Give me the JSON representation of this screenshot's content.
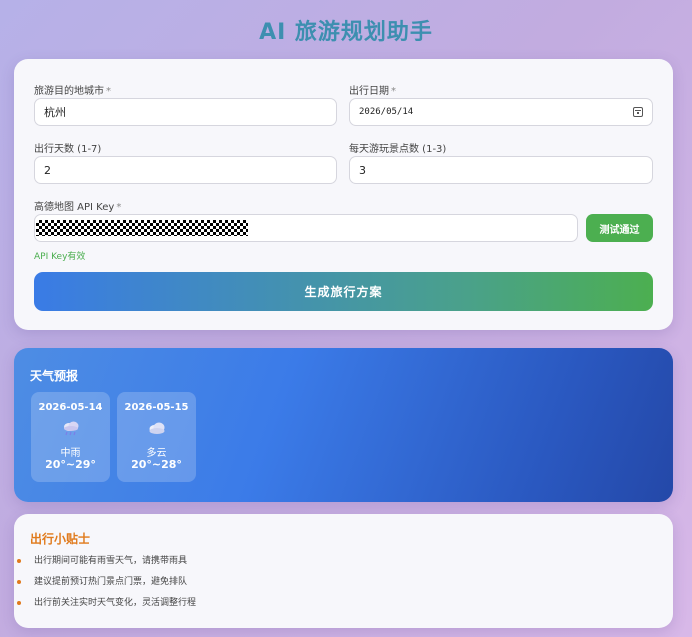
{
  "app": {
    "title": "AI 旅游规划助手"
  },
  "form": {
    "city": {
      "label": "旅游目的地城市",
      "required": "*",
      "value": "杭州"
    },
    "date": {
      "label": "出行日期",
      "required": "*",
      "value": "2026/05/14"
    },
    "days": {
      "label": "出行天数 (1-7)",
      "value": "2"
    },
    "spots": {
      "label": "每天游玩景点数 (1-3)",
      "value": "3"
    },
    "api_key": {
      "label": "高德地图 API Key",
      "required": "*"
    },
    "test_button_label": "测试通过",
    "api_status": "API Key有效",
    "generate_button_label": "生成旅行方案"
  },
  "weather": {
    "title": "天气预报",
    "days": [
      {
        "date": "2026-05-14",
        "icon": "rain-cloud-icon",
        "condition": "中雨",
        "temp": "20°~29°"
      },
      {
        "date": "2026-05-15",
        "icon": "cloud-icon",
        "condition": "多云",
        "temp": "20°~28°"
      }
    ]
  },
  "tips": {
    "title": "出行小贴士",
    "items": [
      "出行期间可能有雨雪天气，请携带雨具",
      "建议提前预订热门景点门票，避免排队",
      "出行前关注实时天气变化，灵活调整行程"
    ]
  },
  "colors": {
    "accent_green": "#4caf50",
    "accent_blue": "#3a7be6",
    "tips_orange": "#e07a1c",
    "title_teal": "#3d8fb0"
  }
}
